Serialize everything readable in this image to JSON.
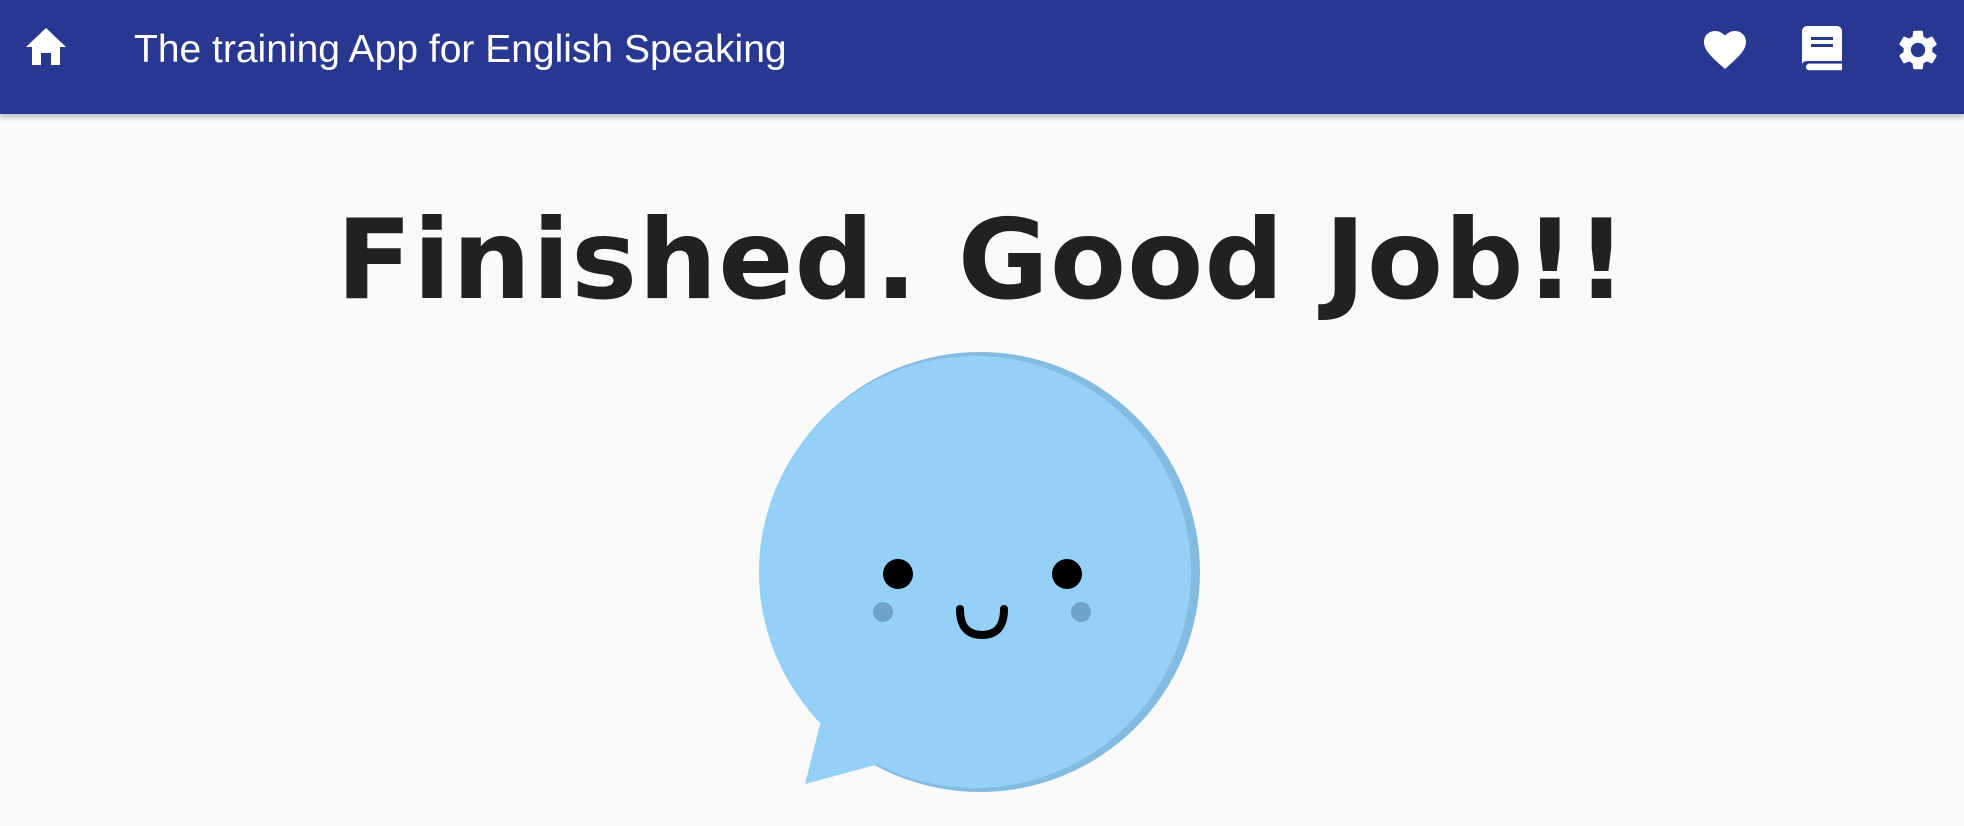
{
  "appbar": {
    "title": "The training App for English Speaking",
    "background": "#283891",
    "icons": {
      "home": "home-icon",
      "favorites": "heart-icon",
      "book": "book-icon",
      "settings": "gear-icon"
    }
  },
  "main": {
    "headline": "Finished. Good Job!!",
    "illustration": "smiling-speech-bubble",
    "bubble_color": "#95d0f6",
    "bubble_shade_color": "#84bbe0"
  }
}
